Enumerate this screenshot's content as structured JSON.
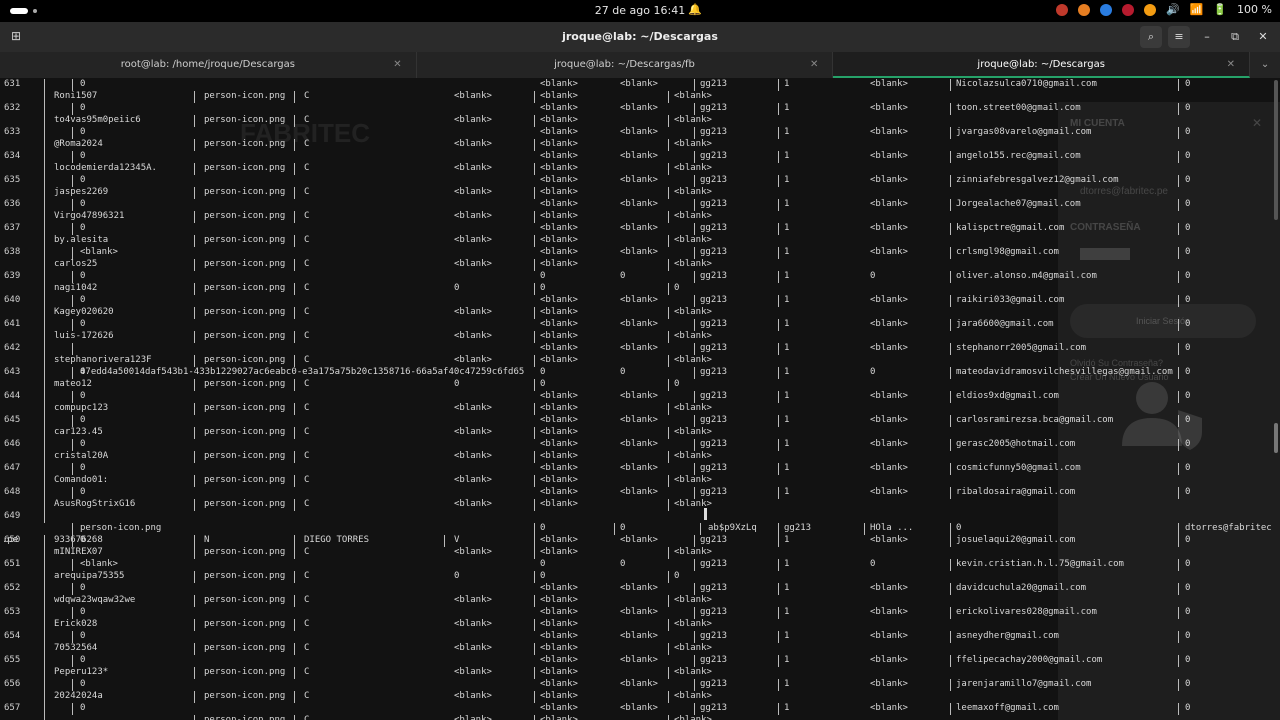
{
  "system": {
    "clock": "27 de ago  16:41",
    "battery": "100 %",
    "tray_colors": [
      "#c0392b",
      "#e67e22",
      "#2a7de1",
      "#b61b2e",
      "#f39c12"
    ]
  },
  "window": {
    "title": "jroque@lab: ~/Descargas"
  },
  "tabs": [
    {
      "label": "root@lab: /home/jroque/Descargas",
      "active": false
    },
    {
      "label": "jroque@lab: ~/Descargas/fb",
      "active": false
    },
    {
      "label": "jroque@lab: ~/Descargas",
      "active": true
    }
  ],
  "background": {
    "watermark": "FABRITEC",
    "panel_title": "MI CUENTA",
    "panel_email": "dtorres@fabritec.pe",
    "panel_password_label": "CONTRASEÑA",
    "panel_button": "Iniciar Sesión",
    "panel_forgot": "Olvidó Su Contraseña?",
    "panel_create": "Crear Un Nuevo Usuario"
  },
  "records": [
    {
      "first": false,
      "id": "631",
      "user": "Roni1507",
      "icon": "person-icon.png",
      "flag": "C",
      "b1": "<blank>",
      "z": "0",
      "ex": "<blank>",
      "zero": "0",
      "ex2": "<blank>",
      "pwd": "gg213",
      "one": "1",
      "ex3": "<blank>",
      "email": "Nicolazsulca0710@gmail.com",
      "last": "0",
      "nextb1": "<blank>"
    },
    {
      "id": "632",
      "user": "to4vas95m0peiic6",
      "icon": "person-icon.png",
      "flag": "C",
      "b1": "<blank>",
      "z": "0",
      "pwd": "gg213",
      "one": "1",
      "email": "toon.street00@gmail.com",
      "last": "0"
    },
    {
      "id": "633",
      "user": "@Roma2024",
      "icon": "person-icon.png",
      "flag": "C",
      "b1": "<blank>",
      "z": "0",
      "pwd": "gg213",
      "one": "1",
      "email": "jvargas08varelo@gmail.com",
      "last": "0"
    },
    {
      "id": "634",
      "user": "locodemierda12345A.",
      "icon": "person-icon.png",
      "flag": "C",
      "b1": "<blank>",
      "z": "0",
      "pwd": "gg213",
      "one": "1",
      "email": "angelo155.rec@gmail.com",
      "last": "0"
    },
    {
      "id": "635",
      "user": "jaspes2269",
      "icon": "person-icon.png",
      "flag": "C",
      "b1": "<blank>",
      "z": "0",
      "pwd": "gg213",
      "one": "1",
      "email": "zinniafebresgalvez12@gmail.com",
      "last": "0"
    },
    {
      "id": "636",
      "user": "Virgo47896321",
      "icon": "person-icon.png",
      "flag": "C",
      "b1": "<blank>",
      "z": "0",
      "pwd": "gg213",
      "one": "1",
      "email": "Jorgealache07@gmail.com",
      "last": "0"
    },
    {
      "id": "637",
      "user": "by.alesita",
      "icon": "person-icon.png",
      "flag": "C",
      "b1": "<blank>",
      "z": "0",
      "pwd": "gg213",
      "one": "1",
      "email": "kalispctre@gmail.com",
      "last": "0"
    },
    {
      "id": "638",
      "user": "carlos25",
      "icon": "person-icon.png",
      "flag": "C",
      "b1": "<blank>",
      "z": "<blank>",
      "pwd": "gg213",
      "one": "1",
      "email": "crlsmgl98@gmail.com",
      "last": "0"
    },
    {
      "id": "639",
      "user": "nagi1042",
      "icon": "person-icon.png",
      "flag": "C",
      "b1": "0",
      "z": "0",
      "pwd": "gg213",
      "one": "1",
      "email": "oliver.alonso.m4@gmail.com",
      "last": "0"
    },
    {
      "id": "640",
      "user": "Kagey020620",
      "icon": "person-icon.png",
      "flag": "C",
      "b1": "<blank>",
      "z": "0",
      "pwd": "gg213",
      "one": "1",
      "email": "raikiri033@gmail.com",
      "last": "0"
    },
    {
      "id": "641",
      "user": "luis-172626",
      "icon": "person-icon.png",
      "flag": "C",
      "b1": "<blank>",
      "z": "0",
      "pwd": "gg213",
      "one": "1",
      "email": "jara6600@gmail.com",
      "last": "0"
    },
    {
      "id": "642",
      "user": "stephanorivera123F",
      "icon": "person-icon.png",
      "flag": "C",
      "b1": "<blank>",
      "z": "",
      "longhash": "47edd4a50014daf543b1-433b1229027ac6eabc0-e3a175a75b20c1358716-66a5af40c47259c6fd65",
      "pwd": "gg213",
      "one": "1",
      "email": "stephanorr2005@gmail.com",
      "last": "0"
    },
    {
      "id": "643",
      "user": "mateo12",
      "icon": "person-icon.png",
      "flag": "C",
      "b1": "0",
      "z": "0",
      "pwd": "gg213",
      "one": "1",
      "email": "mateodavidramosvilchesvillegas@gmail.com",
      "last": "0"
    },
    {
      "id": "644",
      "user": "compupc123",
      "icon": "person-icon.png",
      "flag": "C",
      "b1": "<blank>",
      "z": "0",
      "pwd": "gg213",
      "one": "1",
      "email": "eldios9xd@gmail.com",
      "last": "0"
    },
    {
      "id": "645",
      "user": "car123.45",
      "icon": "person-icon.png",
      "flag": "C",
      "b1": "<blank>",
      "z": "0",
      "pwd": "gg213",
      "one": "1",
      "email": "carlosramirezsa.bca@gmail.com",
      "last": "0"
    },
    {
      "id": "646",
      "user": "cristal20A",
      "icon": "person-icon.png",
      "flag": "C",
      "b1": "<blank>",
      "z": "0",
      "pwd": "gg213",
      "one": "1",
      "email": "gerasc2005@hotmail.com",
      "last": "0"
    },
    {
      "id": "647",
      "user": "Comando01:",
      "icon": "person-icon.png",
      "flag": "C",
      "b1": "<blank>",
      "z": "0",
      "pwd": "gg213",
      "one": "1",
      "email": "cosmicfunny50@gmail.com",
      "last": "0"
    },
    {
      "id": "648",
      "user": "AsusRogStrixG16",
      "icon": "person-icon.png",
      "flag": "C",
      "b1": "<blank>",
      "z": "0",
      "pwd": "gg213",
      "one": "1",
      "email": "ribaldosaira@gmail.com",
      "last": "0"
    },
    {
      "special": true,
      "id": "649",
      "icon": "person-icon.png",
      "s_a": "0",
      "s_b": "0",
      "s_pwd": "ab$p9XzLq",
      "s_gg": "gg213",
      "s_hola": "HOla ...",
      "s_zero": "0",
      "s_email": "dtorres@fabritec",
      "s_pe": ".pe",
      "phone": "933676268",
      "flag": "N",
      "name": "DIEGO TORRES",
      "flag2": "V"
    },
    {
      "id": "650",
      "user": "mINIREX07",
      "icon": "person-icon.png",
      "flag": "C",
      "b1": "<blank>",
      "z": "0",
      "pwd": "gg213",
      "one": "1",
      "email": "josuelaqui20@gmail.com",
      "last": "0"
    },
    {
      "id": "651",
      "user": "arequipa75355",
      "icon": "person-icon.png",
      "flag": "C",
      "b1": "0",
      "z": "<blank>",
      "pwd": "gg213",
      "one": "1",
      "email": "kevin.cristian.h.l.75@gmail.com",
      "last": "0"
    },
    {
      "id": "652",
      "user": "wdqwa23wqaw32we",
      "icon": "person-icon.png",
      "flag": "C",
      "b1": "<blank>",
      "z": "0",
      "pwd": "gg213",
      "one": "1",
      "email": "davidcuchula20@gmail.com",
      "last": "0"
    },
    {
      "id": "653",
      "user": "Erick028",
      "icon": "person-icon.png",
      "flag": "C",
      "b1": "<blank>",
      "z": "0",
      "pwd": "gg213",
      "one": "1",
      "email": "erickolivares028@gmail.com",
      "last": "0"
    },
    {
      "id": "654",
      "user": "70532564",
      "icon": "person-icon.png",
      "flag": "C",
      "b1": "<blank>",
      "z": "0",
      "pwd": "gg213",
      "one": "1",
      "email": "asneydher@gmail.com",
      "last": "0"
    },
    {
      "id": "655",
      "user": "Peperu123*",
      "icon": "person-icon.png",
      "flag": "C",
      "b1": "<blank>",
      "z": "0",
      "pwd": "gg213",
      "one": "1",
      "email": "ffelipecachay2000@gmail.com",
      "last": "0"
    },
    {
      "id": "656",
      "user": "20242024a",
      "icon": "person-icon.png",
      "flag": "C",
      "b1": "<blank>",
      "z": "0",
      "pwd": "gg213",
      "one": "1",
      "email": "jarenjaramillo7@gmail.com",
      "last": "0"
    },
    {
      "id": "657",
      "user": "",
      "icon": "person-icon.png",
      "flag": "C",
      "b1": "<blank>",
      "z": "0",
      "pwd": "gg213",
      "one": "1",
      "email": "leemaxoff@gmail.com",
      "last": "0"
    }
  ]
}
